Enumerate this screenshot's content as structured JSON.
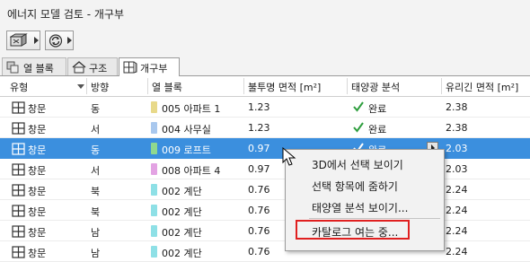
{
  "window": {
    "title": "에너지 모델 검토 - 개구부"
  },
  "toolbar": {
    "buttons": [
      {
        "icon": "model-view-icon"
      },
      {
        "icon": "refresh-icon"
      }
    ]
  },
  "tabs": [
    {
      "label": "열 블록",
      "icon": "thermal-block-icon",
      "active": false
    },
    {
      "label": "구조",
      "icon": "house-icon",
      "active": false
    },
    {
      "label": "개구부",
      "icon": "opening-icon",
      "active": true
    }
  ],
  "table": {
    "columns": [
      "유형",
      "방향",
      "열 블록",
      "불투명 면적 [m²]",
      "태양광 분석",
      "유리긴 면적 [m²]"
    ],
    "rows": [
      {
        "type": "창문",
        "orientation": "동",
        "block": "005 아파트 1",
        "color": "#e8d98a",
        "opaque": "1.23",
        "solar": "완료",
        "glazing": "2.38",
        "selected": false
      },
      {
        "type": "창문",
        "orientation": "서",
        "block": "004 사무실",
        "color": "#a9c8ee",
        "opaque": "1.23",
        "solar": "완료",
        "glazing": "2.38",
        "selected": false
      },
      {
        "type": "창문",
        "orientation": "동",
        "block": "009 로프트",
        "color": "#8fd88f",
        "opaque": "0.97",
        "solar": "완료",
        "glazing": "2.03",
        "selected": true
      },
      {
        "type": "창문",
        "orientation": "서",
        "block": "008 아파트 4",
        "color": "#e3a3e3",
        "opaque": "0.97",
        "solar": "",
        "glazing": "2.03",
        "selected": false
      },
      {
        "type": "창문",
        "orientation": "북",
        "block": "002 계단",
        "color": "#8ee0e6",
        "opaque": "0.76",
        "solar": "",
        "glazing": "2.24",
        "selected": false
      },
      {
        "type": "창문",
        "orientation": "북",
        "block": "002 계단",
        "color": "#8ee0e6",
        "opaque": "0.76",
        "solar": "",
        "glazing": "2.24",
        "selected": false
      },
      {
        "type": "창문",
        "orientation": "남",
        "block": "002 계단",
        "color": "#8ee0e6",
        "opaque": "0.76",
        "solar": "",
        "glazing": "2.24",
        "selected": false
      },
      {
        "type": "창문",
        "orientation": "남",
        "block": "002 계단",
        "color": "#8ee0e6",
        "opaque": "0.76",
        "solar": "",
        "glazing": "2.24",
        "selected": false
      }
    ]
  },
  "context_menu": {
    "items": [
      "3D에서 선택 보이기",
      "선택 항목에 줌하기",
      "태양열 분석 보이기...",
      "카탈로그 여는 중..."
    ],
    "highlighted_index": 3
  },
  "colors": {
    "selection": "#3b8fde",
    "check": "#2e9e3e",
    "highlight_box": "#e02020"
  }
}
